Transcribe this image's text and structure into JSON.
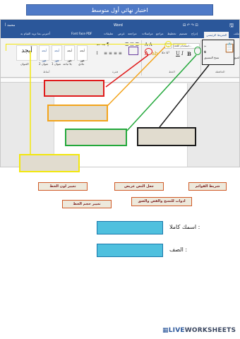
{
  "title": "اختبار نهائي أول متوسط",
  "screenshot": {
    "app_title": "Word",
    "top_right_text": "محمد أ",
    "font_face": "Font Face PDF",
    "tell_me": "أخبرني بما تريد القيام به",
    "tabs": [
      "ملف",
      "الشريط الرئيسي",
      "إدراج",
      "تصميم",
      "تخطيط",
      "مراجع",
      "مراسلات",
      "مراجعة",
      "عرض",
      "تعليقات"
    ],
    "active_tab": "الشريط الرئيسي",
    "paste_label": "لصق",
    "format_painter_label": "نسخ التنسيق",
    "font_name": "(استخدام اللغة...",
    "font_size": "١٤",
    "style_sample": "أبجد هوز",
    "style_names": [
      "عادي",
      "بلا تباعد",
      "عنوان 1",
      "عنوان 2",
      "العنوان"
    ],
    "style_big": "أبجد",
    "group_labels": [
      "الحافظة",
      "الخط",
      "فقرة",
      "أنماط"
    ]
  },
  "labels": {
    "font_color": "تغيير لون الخط",
    "bold": "جعل النص عريض",
    "bullets": "شريط القوائم",
    "font_size": "تغيير حجم الخط",
    "clipboard": "ادوات للنسخ والقص والصق"
  },
  "form": {
    "name_label": "اسمك كاملا :",
    "class_label": "الصف :"
  },
  "footer": {
    "logo_a": "LIVE",
    "logo_b": "WORKSHEETS"
  },
  "colors": {
    "red": "#e01b1b",
    "orange": "#f3a41b",
    "green": "#23a83b",
    "black": "#1b1b1b",
    "yellow": "#f2e70d",
    "purple": "#6a3fa0",
    "input_fill": "#4fc0de"
  }
}
